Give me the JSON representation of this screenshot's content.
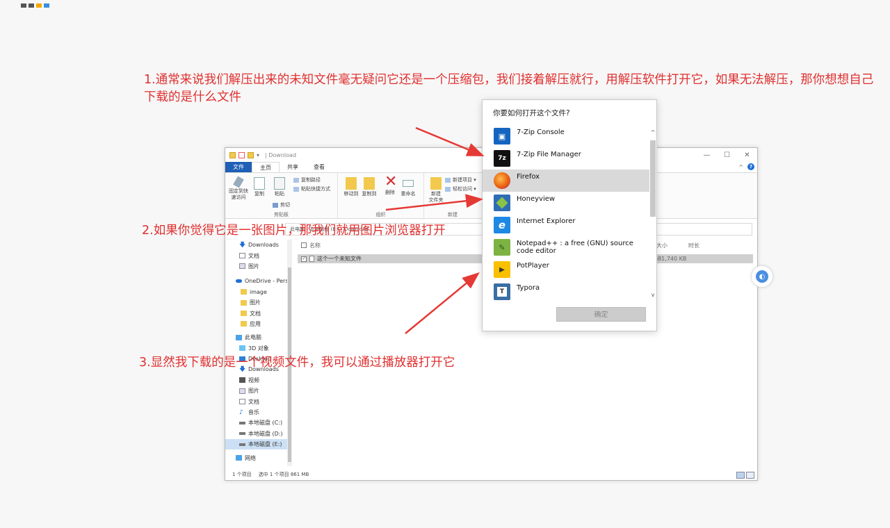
{
  "annotations": {
    "step1": "1.通常来说我们解压出来的未知文件毫无疑问它还是一个压缩包，我们接着解压就行，用解压软件打开它，如果无法解压，那你想想自己下载的是什么文件",
    "step2": "2.如果你觉得它是一张图片，那我们就用图片浏览器打开",
    "step3": "3.显然我下载的是一个视频文件，我可以通过播放器打开它"
  },
  "explorer": {
    "title": "| Download",
    "tabs": [
      "文件",
      "主页",
      "共享",
      "查看"
    ],
    "ribbon": {
      "clipboard": {
        "pin": "固定到快\n速访问",
        "copy": "复制",
        "paste": "粘贴",
        "copy_path": "复制路径",
        "paste_shortcut": "粘贴快捷方式",
        "cut": "剪切",
        "caption": "剪贴板"
      },
      "organize": {
        "move_to": "移动到",
        "copy_to": "复制到",
        "delete": "删除",
        "rename": "重命名",
        "caption": "组织"
      },
      "new": {
        "new_folder": "新建\n文件夹",
        "new_item": "新建项目 ▾",
        "easy_access": "轻松访问 ▾",
        "caption": "新建"
      }
    },
    "address": "此电脑 › 本地磁盘 (E:) › Download",
    "sidebar": [
      "Downloads",
      "文档",
      "图片",
      "OneDrive - Pers",
      "image",
      "图片",
      "文档",
      "应用",
      "此电脑",
      "3D 对象",
      "Desktop",
      "Downloads",
      "视频",
      "图片",
      "文档",
      "音乐",
      "本地磁盘 (C:)",
      "本地磁盘 (D:)",
      "本地磁盘 (E:)",
      "网络"
    ],
    "columns": {
      "name": "名称",
      "size": "大小",
      "time": "时长"
    },
    "file": {
      "name": "这个一个未知文件",
      "size": "881,740 KB"
    },
    "status": {
      "count": "1 个项目",
      "selected": "选中 1 个项目  861 MB"
    }
  },
  "dialog": {
    "title": "你要如何打开这个文件?",
    "apps": [
      {
        "name": "7-Zip Console",
        "icon": "7zip-console-icon",
        "color": "#1565c0"
      },
      {
        "name": "7-Zip File Manager",
        "icon": "7zip-icon",
        "color": "#111111"
      },
      {
        "name": "Firefox",
        "icon": "firefox-icon",
        "color": "#e8590c"
      },
      {
        "name": "Honeyview",
        "icon": "honeyview-icon",
        "color": "#2e7d32"
      },
      {
        "name": "Internet Explorer",
        "icon": "ie-icon",
        "color": "#1e88e5"
      },
      {
        "name": "Notepad++ : a free (GNU) source code editor",
        "icon": "notepadpp-icon",
        "color": "#7cb342"
      },
      {
        "name": "PotPlayer",
        "icon": "potplayer-icon",
        "color": "#f9c000"
      },
      {
        "name": "Typora",
        "icon": "typora-icon",
        "color": "#3a6ea5"
      }
    ],
    "ok": "确定"
  }
}
